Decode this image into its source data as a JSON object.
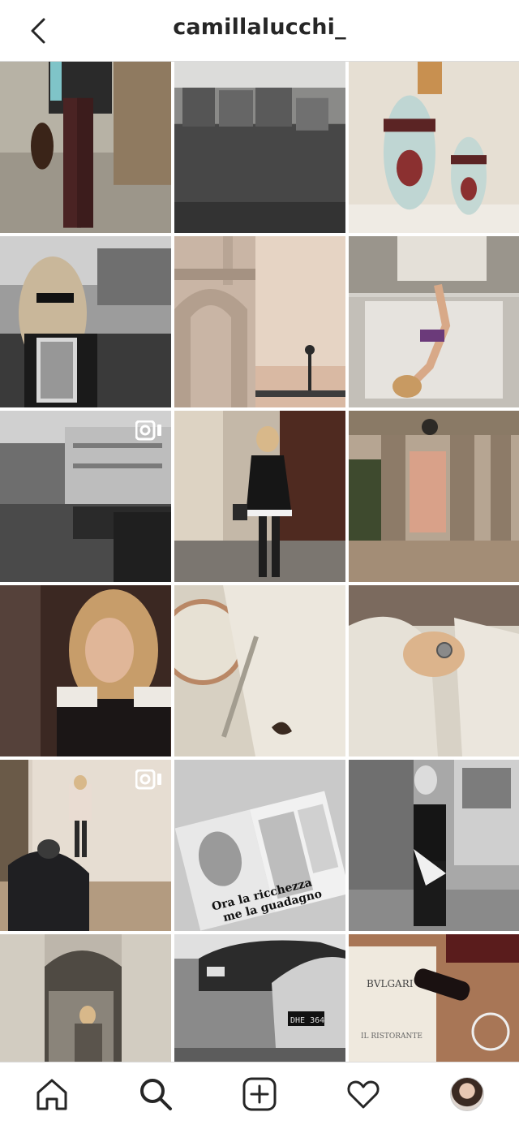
{
  "header": {
    "username": "camillalucchi_"
  },
  "icons": {
    "back": "chevron-left-icon",
    "video": "igtv-video-icon",
    "home": "home-icon",
    "search": "search-icon",
    "new_post": "plus-square-icon",
    "activity": "heart-icon",
    "profile": "profile-avatar"
  },
  "grid": {
    "posts": [
      {
        "id": "1",
        "kind": "street-boots"
      },
      {
        "id": "2",
        "kind": "sofa"
      },
      {
        "id": "3",
        "kind": "eggs"
      },
      {
        "id": "4",
        "kind": "woman-boat-bw"
      },
      {
        "id": "5",
        "kind": "doge-palace"
      },
      {
        "id": "6",
        "kind": "woman-bed"
      },
      {
        "id": "7",
        "kind": "venice-canal-bw",
        "video": true
      },
      {
        "id": "8",
        "kind": "woman-black-dress"
      },
      {
        "id": "9",
        "kind": "arcade-courtyard"
      },
      {
        "id": "10",
        "kind": "portrait-blonde"
      },
      {
        "id": "11",
        "kind": "table-setting"
      },
      {
        "id": "12",
        "kind": "hand-ring"
      },
      {
        "id": "13",
        "kind": "photoshoot",
        "video": true
      },
      {
        "id": "14",
        "kind": "magazine",
        "magazine_title": "Ora la ricchezza me la guadagno"
      },
      {
        "id": "15",
        "kind": "woman-tram-bw"
      },
      {
        "id": "16",
        "kind": "woman-arcade"
      },
      {
        "id": "17",
        "kind": "cars-bw",
        "plate": "DHE 364"
      },
      {
        "id": "18",
        "kind": "bvlgari-menu",
        "brand": "BVLGARI",
        "menu_title": "IL RISTORANTE"
      },
      {
        "id": "19",
        "kind": "partial-1"
      },
      {
        "id": "20",
        "kind": "partial-2"
      },
      {
        "id": "21",
        "kind": "partial-3"
      }
    ]
  }
}
